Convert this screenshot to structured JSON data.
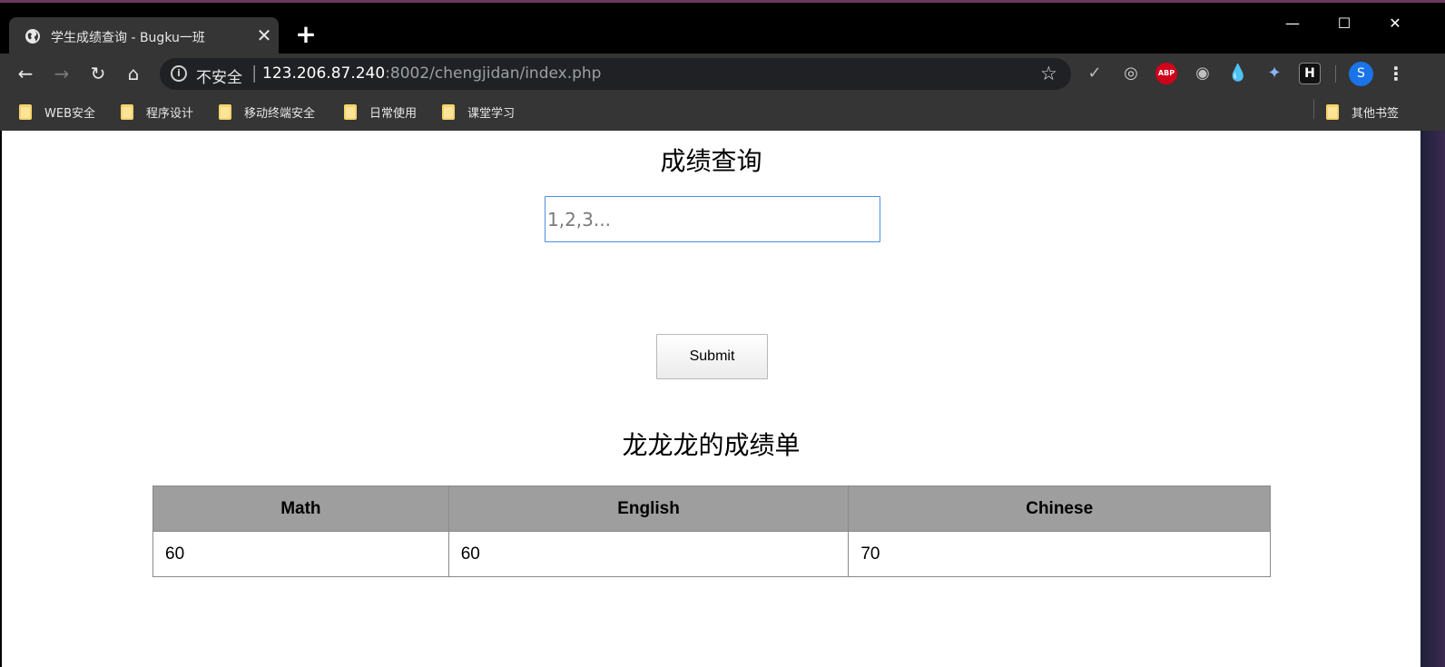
{
  "browser": {
    "tab": {
      "title": "学生成绩查询 - Bugku一班",
      "close_label": "✕"
    },
    "new_tab_label": "+",
    "window_controls": {
      "minimize": "—",
      "maximize": "☐",
      "close": "✕"
    },
    "toolbar": {
      "back": "←",
      "forward": "→",
      "reload": "↻",
      "home": "⌂",
      "security_label": "不安全",
      "separator": "|",
      "url_host": "123.206.87.240",
      "url_rest": ":8002/chengjidan/index.php",
      "bookmark_star": "☆",
      "menu": "⋮",
      "profile_initial": "S"
    },
    "extensions": [
      {
        "icon": "check-icon",
        "glyph": "✓",
        "color": "#bdbdbd"
      },
      {
        "icon": "lightbulb-icon",
        "glyph": "◎",
        "color": "#cfcfcf"
      },
      {
        "icon": "adblock-icon",
        "glyph": "ABP",
        "color": "#d0021b"
      },
      {
        "icon": "world-icon",
        "glyph": "◉",
        "color": "#bfbfbf"
      },
      {
        "icon": "droplet-icon",
        "glyph": "💧",
        "color": "#1e88e5"
      },
      {
        "icon": "bird-icon",
        "glyph": "✦",
        "color": "#8ab4f8"
      },
      {
        "icon": "h-icon",
        "glyph": "H",
        "color": "#111111"
      }
    ],
    "bookmarks": [
      {
        "label": "WEB安全"
      },
      {
        "label": "程序设计"
      },
      {
        "label": "移动终端安全"
      },
      {
        "label": "日常使用"
      },
      {
        "label": "课堂学习"
      }
    ],
    "other_bookmarks": "其他书签"
  },
  "page": {
    "heading": "成绩查询",
    "input": {
      "placeholder": "1,2,3...",
      "value": ""
    },
    "submit_label": "Submit",
    "report_title": "龙龙龙的成绩单",
    "table": {
      "headers": [
        "Math",
        "English",
        "Chinese"
      ],
      "rows": [
        [
          "60",
          "60",
          "70"
        ]
      ]
    }
  }
}
